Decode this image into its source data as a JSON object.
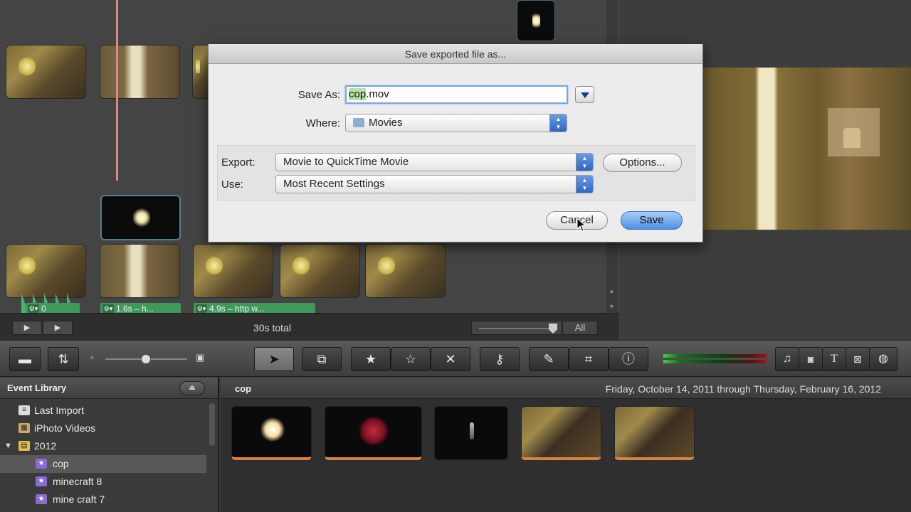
{
  "project": {
    "clip_labels": [
      "0",
      "1.6s – h...",
      "4.9s – http     w..."
    ],
    "total": "30s total",
    "zoom_all": "All"
  },
  "toolbar": {
    "icons": [
      "camera-icon",
      "swap-icon",
      "small-frame-icon",
      "person-icon",
      "arrow-cursor-icon",
      "crop-select-icon",
      "star-filled-icon",
      "star-outline-icon",
      "reject-x-icon",
      "key-icon",
      "eyedropper-icon",
      "crop-icon",
      "info-icon",
      "music-note-icon",
      "photo-camera-icon",
      "title-t-icon",
      "transition-icon",
      "globe-icon"
    ]
  },
  "library": {
    "title": "Event Library",
    "items": [
      {
        "label": "Last Import"
      },
      {
        "label": "iPhoto Videos"
      },
      {
        "label": "2012"
      },
      {
        "label": "cop"
      },
      {
        "label": "minecraft 8"
      },
      {
        "label": "mine craft 7"
      }
    ]
  },
  "browser": {
    "event_name": "cop",
    "date_range": "Friday, October 14, 2011 through Thursday, February 16, 2012"
  },
  "dialog": {
    "title": "Save exported file as...",
    "save_as_label": "Save As:",
    "filename_selected": "cop",
    "filename_ext": ".mov",
    "where_label": "Where:",
    "where_value": "Movies",
    "export_label": "Export:",
    "export_value": "Movie to QuickTime Movie",
    "options_label": "Options...",
    "use_label": "Use:",
    "use_value": "Most Recent Settings",
    "cancel_label": "Cancel",
    "save_label": "Save"
  },
  "colors": {
    "accent": "#4f8fe6",
    "clip_label_green": "#3f9a5a",
    "selection_green": "#b7e3a5"
  }
}
